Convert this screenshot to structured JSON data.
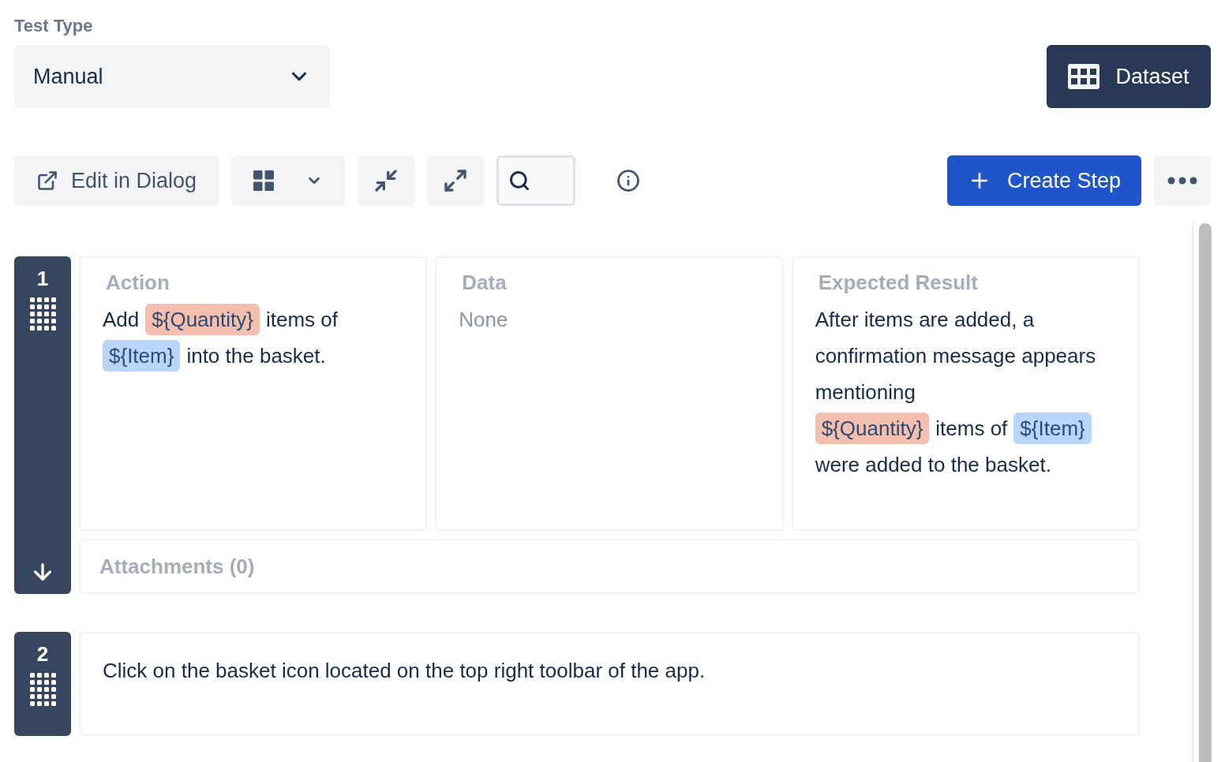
{
  "test_type": {
    "label": "Test Type",
    "value": "Manual"
  },
  "dataset_button": {
    "label": "Dataset"
  },
  "toolbar": {
    "edit_button": "Edit in Dialog",
    "create_button": "Create Step"
  },
  "steps": [
    {
      "number": "1",
      "expanded": true,
      "columns": [
        {
          "heading": "Action",
          "content": [
            {
              "kind": "text",
              "text": "Add"
            },
            {
              "kind": "param",
              "text": "${Quantity}",
              "color": "#f4bfae"
            },
            {
              "kind": "text",
              "text": "items of"
            },
            {
              "kind": "param",
              "text": "${Item}",
              "color": "#b9d5fb"
            },
            {
              "kind": "text",
              "text": "into the basket."
            }
          ]
        },
        {
          "heading": "Data",
          "content": [
            {
              "kind": "empty",
              "text": "None"
            }
          ]
        },
        {
          "heading": "Expected Result",
          "content": [
            {
              "kind": "text",
              "text": "After items are added, a confirmation message appears mentioning"
            },
            {
              "kind": "param",
              "text": "${Quantity}",
              "color": "#f4bfae"
            },
            {
              "kind": "text",
              "text": "items of"
            },
            {
              "kind": "param",
              "text": "${Item}",
              "color": "#b9d5fb"
            },
            {
              "kind": "text",
              "text": "were added to the basket."
            }
          ]
        }
      ],
      "attachments": "Attachments (0)"
    },
    {
      "number": "2",
      "expanded": false,
      "summary": "Click on the basket icon located on the top right toolbar of the app."
    }
  ]
}
